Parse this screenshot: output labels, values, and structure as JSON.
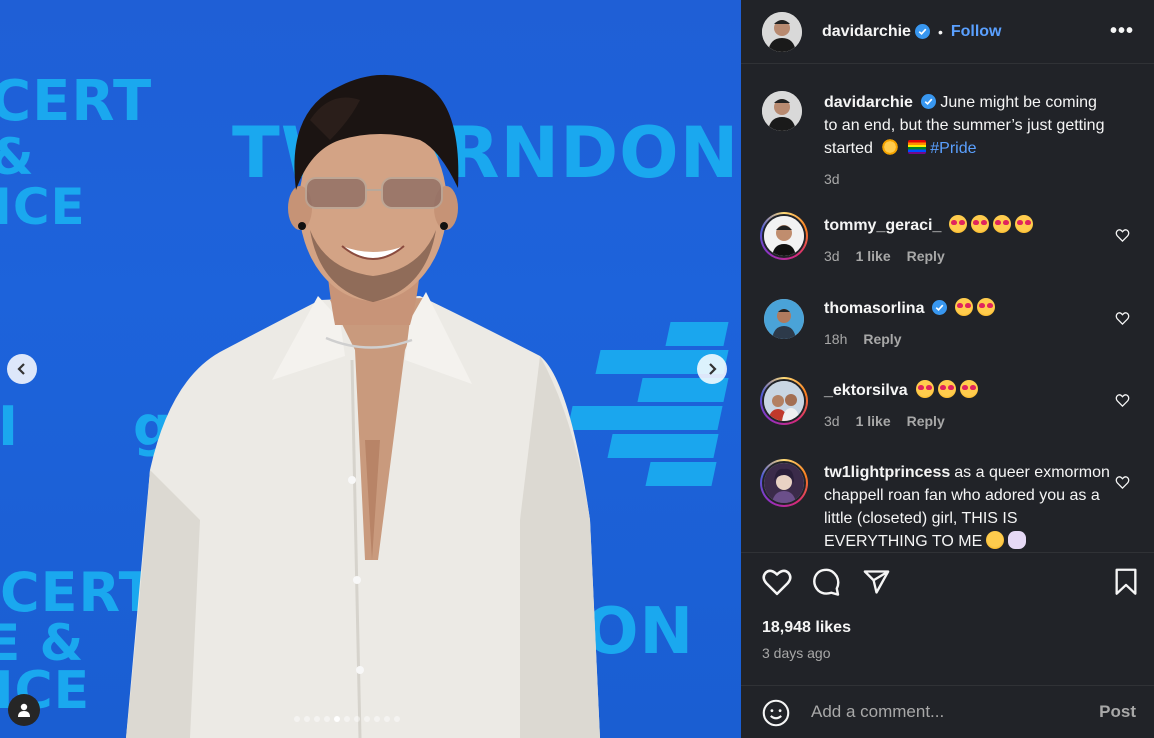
{
  "post": {
    "author": "davidarchie",
    "follow_label": "Follow",
    "separator": "•",
    "more_label": "•••",
    "caption_text": "June might be coming to an end, but the summer’s just getting started",
    "caption_hashtag": "#Pride",
    "caption_time": "3d",
    "likes": "18,948 likes",
    "time_ago": "3 days ago",
    "comment_placeholder": "Add a comment...",
    "post_label": "Post",
    "carousel_count": 11,
    "carousel_active_index": 4
  },
  "photo": {
    "backdrop_texts": [
      "CERT",
      "&",
      "NCE",
      "TWINRNDON",
      "CERT",
      "E &",
      "NCE",
      "DON",
      "g",
      "I"
    ],
    "accent_color": "#1aa6ee",
    "background_color": "#1d63db"
  },
  "comments": [
    {
      "username": "tommy_geraci_",
      "text": "",
      "emoji_count": 4,
      "time": "3d",
      "likes": "1 like",
      "reply": "Reply",
      "has_story": true,
      "verified": false
    },
    {
      "username": "thomasorlina",
      "text": "",
      "emoji_count": 2,
      "time": "18h",
      "likes": "",
      "reply": "Reply",
      "has_story": false,
      "verified": true
    },
    {
      "username": "_ektorsilva",
      "text": "",
      "emoji_count": 3,
      "time": "3d",
      "likes": "1 like",
      "reply": "Reply",
      "has_story": true,
      "verified": false
    },
    {
      "username": "tw1lightprincess",
      "text": "as a queer exmormon chappell roan fan who adored you as a little (closeted) girl, THIS IS EVERYTHING TO ME",
      "emoji_count": 0,
      "time": "",
      "likes": "",
      "reply": "",
      "has_story": true,
      "verified": false
    }
  ],
  "colors": {
    "link_blue": "#5aa0ff",
    "sidebar_bg": "#212328",
    "muted_text": "#a8a8a8"
  },
  "icons": [
    "heart-icon",
    "comment-icon",
    "share-icon",
    "bookmark-icon",
    "emoji-icon",
    "verified-icon",
    "user-tag-icon",
    "chevron-left-icon",
    "chevron-right-icon"
  ]
}
